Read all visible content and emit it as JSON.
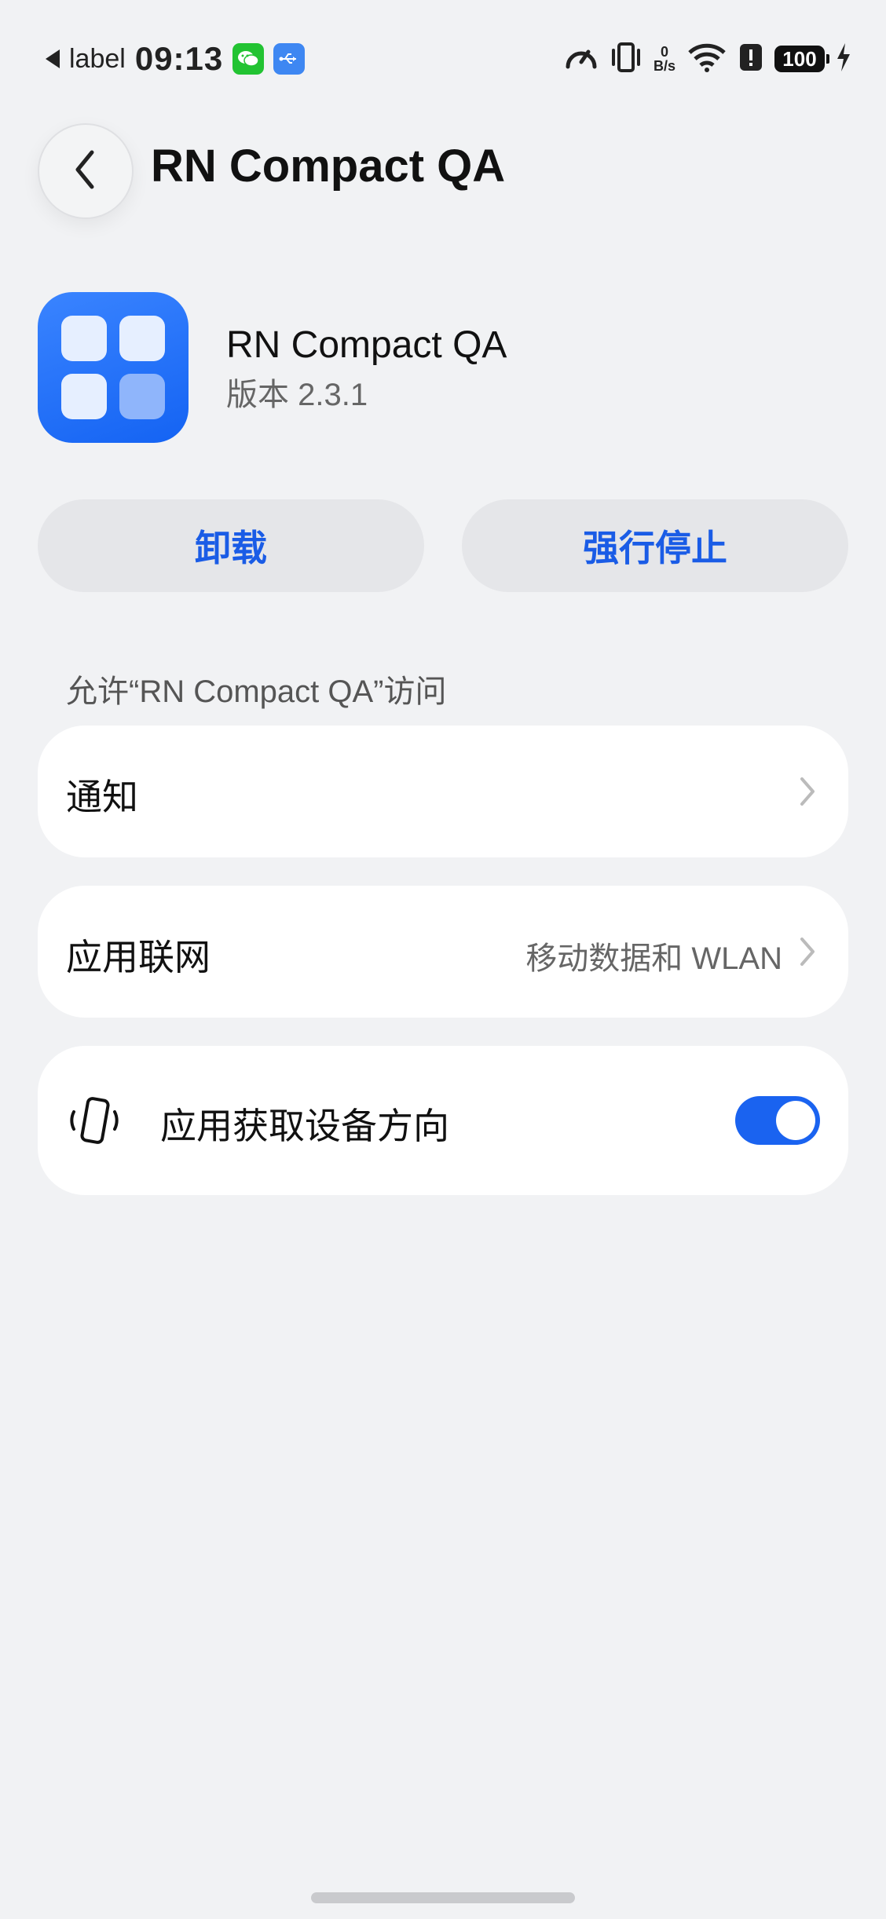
{
  "status_bar": {
    "label": "label",
    "time": "09:13",
    "net_speed_value": "0",
    "net_speed_unit": "B/s",
    "battery": "100"
  },
  "header": {
    "title": "RN Compact QA"
  },
  "app": {
    "name": "RN Compact QA",
    "version": "版本 2.3.1"
  },
  "actions": {
    "uninstall_label": "卸载",
    "force_stop_label": "强行停止"
  },
  "permissions": {
    "section_label": "允许“RN Compact QA”访问",
    "notification_label": "通知",
    "network_label": "应用联网",
    "network_value": "移动数据和 WLAN",
    "orientation_label": "应用获取设备方向",
    "orientation_enabled": true
  },
  "colors": {
    "accent": "#1a63f0",
    "background": "#f1f2f4",
    "card": "#ffffff"
  }
}
